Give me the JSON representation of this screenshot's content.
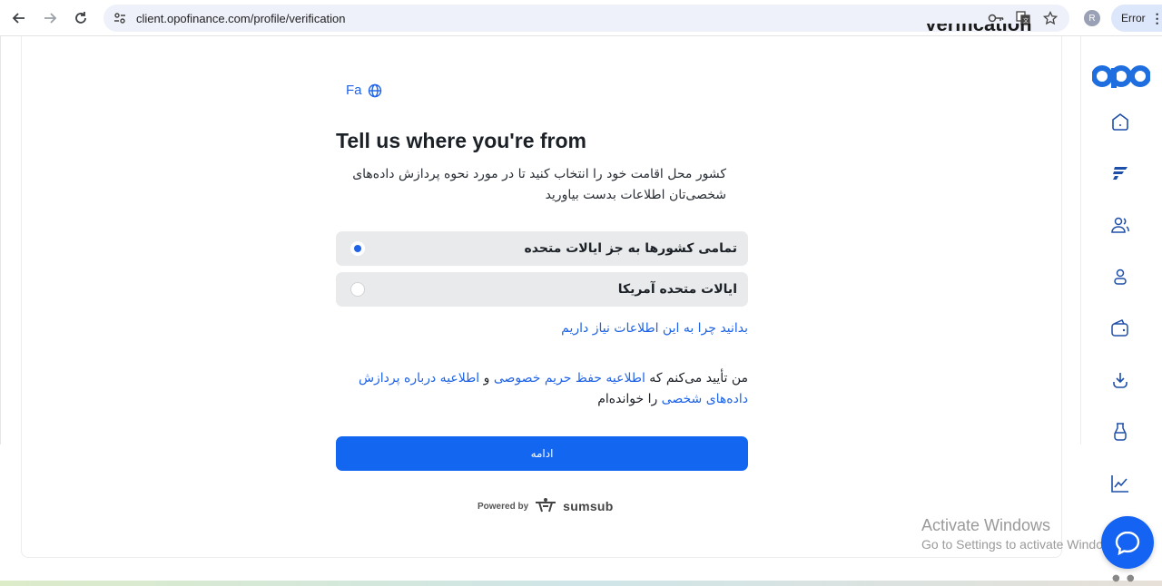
{
  "browser": {
    "url": "client.opofinance.com/profile/verification",
    "profile_initial": "R",
    "error_label": "Error"
  },
  "page": {
    "heading_partial": "Verification"
  },
  "widget": {
    "language": "Fa",
    "title": "Tell us where you're from",
    "description": "کشور محل اقامت خود را انتخاب کنید تا در مورد نحوه پردازش داده‌های شخصی‌تان اطلاعات بدست بیاورید",
    "options": [
      {
        "label": "تمامی کشورها به جز ایالات متحده",
        "selected": true
      },
      {
        "label": "ایالات متحده آمریکا",
        "selected": false
      }
    ],
    "why_link": "بدانید چرا به این اطلاعات نیاز داریم",
    "consent": {
      "prefix": "من تأیید می‌کنم که ",
      "privacy_link": "اطلاعیه حفظ حریم خصوصی",
      "and": " و ",
      "processing_link": "اطلاعیه درباره پردازش داده‌های شخصی",
      "suffix": " را خوانده‌ام"
    },
    "continue_label": "ادامه",
    "powered_by": "Powered by",
    "brand": "sumsub"
  },
  "sidebar": {
    "logo": "opo",
    "icons": [
      "home-icon",
      "flag-icon",
      "users-icon",
      "user-icon",
      "wallet-icon",
      "download-icon",
      "flask-icon",
      "chart-icon"
    ]
  },
  "watermark": {
    "line1": "Activate Windows",
    "line2": "Go to Settings to activate Windows."
  },
  "colors": {
    "accent": "#1f63e7",
    "button": "#1366f0",
    "option_bg": "#e9eaeb"
  }
}
